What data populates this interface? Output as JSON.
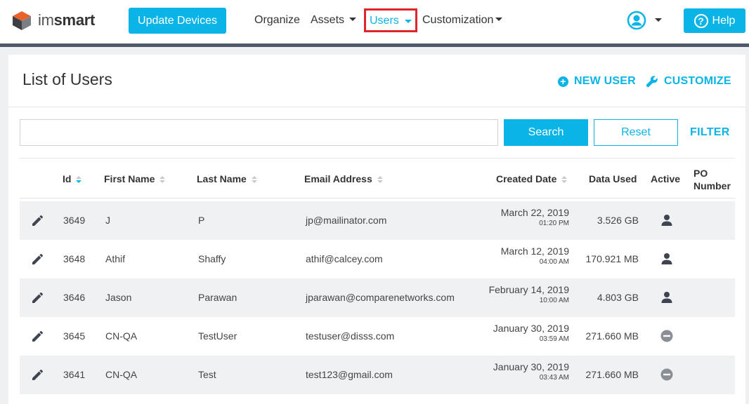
{
  "header": {
    "logo_light": "im",
    "logo_bold": "smart",
    "update_button": "Update Devices",
    "nav": {
      "organize": "Organize",
      "assets": "Assets",
      "users": "Users",
      "customization": "Customization"
    },
    "help_button": "Help",
    "help_symbol": "?"
  },
  "page": {
    "title": "List of Users",
    "new_user": "NEW USER",
    "customize": "CUSTOMIZE",
    "search_button": "Search",
    "reset_button": "Reset",
    "filter": "FILTER",
    "search_value": ""
  },
  "table": {
    "columns": {
      "id": "Id",
      "first_name": "First Name",
      "last_name": "Last Name",
      "email": "Email Address",
      "created": "Created Date",
      "data_used": "Data Used",
      "active": "Active",
      "po_line1": "PO",
      "po_line2": "Number"
    },
    "rows": [
      {
        "id": "3649",
        "first": "J",
        "last": "P",
        "email": "jp@mailinator.com",
        "date": "March 22, 2019",
        "time": "01:20 PM",
        "data_used": "3.526 GB",
        "active": "active-user-icon"
      },
      {
        "id": "3648",
        "first": "Athif",
        "last": "Shaffy",
        "email": "athif@calcey.com",
        "date": "March 12, 2019",
        "time": "04:00 AM",
        "data_used": "170.921 MB",
        "active": "active-user-icon"
      },
      {
        "id": "3646",
        "first": "Jason",
        "last": "Parawan",
        "email": "jparawan@comparenetworks.com",
        "date": "February 14, 2019",
        "time": "10:00 AM",
        "data_used": "4.803 GB",
        "active": "active-user-icon"
      },
      {
        "id": "3645",
        "first": "CN-QA",
        "last": "TestUser",
        "email": "testuser@disss.com",
        "date": "January 30, 2019",
        "time": "03:59 AM",
        "data_used": "271.660 MB",
        "active": "inactive-minus-icon"
      },
      {
        "id": "3641",
        "first": "CN-QA",
        "last": "Test",
        "email": "test123@gmail.com",
        "date": "January 30, 2019",
        "time": "03:43 AM",
        "data_used": "271.660 MB",
        "active": "inactive-minus-icon"
      }
    ]
  },
  "colors": {
    "accent": "#0ab4e6",
    "highlight_border": "#e0242c",
    "nav_divider": "#4d5868"
  }
}
